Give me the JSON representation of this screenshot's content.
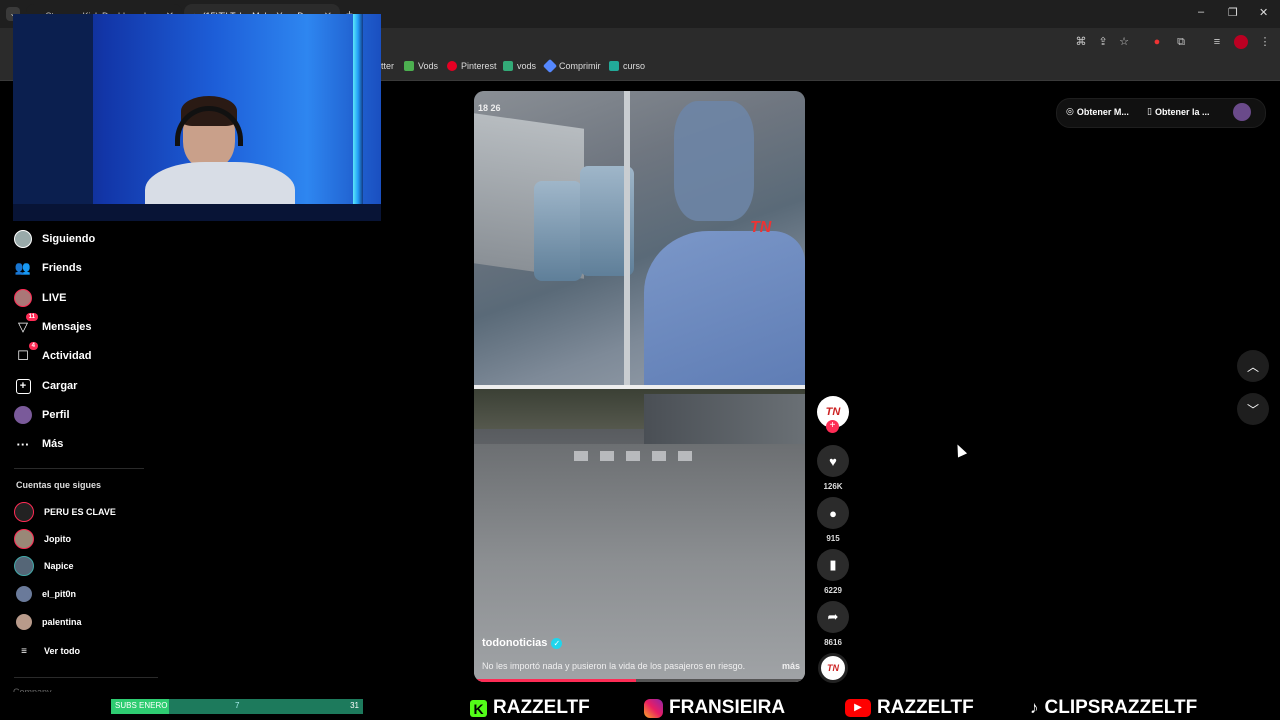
{
  "browser": {
    "tabs": [
      {
        "label": "Stream - Kick Dashboard"
      },
      {
        "label": "(15)TikTok - Make Your Day"
      }
    ],
    "bookmarks": [
      {
        "label": "tter"
      },
      {
        "label": "Vods"
      },
      {
        "label": "Pinterest"
      },
      {
        "label": "vods"
      },
      {
        "label": "Comprimir"
      },
      {
        "label": "curso"
      }
    ]
  },
  "sidebar": {
    "nav": [
      {
        "label": "Siguiendo",
        "icon": "following-icon"
      },
      {
        "label": "Friends",
        "icon": "friends-icon"
      },
      {
        "label": "LIVE",
        "icon": "live-icon"
      },
      {
        "label": "Mensajes",
        "icon": "messages-icon",
        "badge": "11"
      },
      {
        "label": "Actividad",
        "icon": "activity-icon",
        "badge": "4"
      },
      {
        "label": "Cargar",
        "icon": "upload-icon"
      },
      {
        "label": "Perfil",
        "icon": "profile-icon"
      },
      {
        "label": "Más",
        "icon": "more-icon"
      }
    ],
    "following_title": "Cuentas que sigues",
    "accounts": [
      {
        "name": "PERU ES CLAVE"
      },
      {
        "name": "Jopito"
      },
      {
        "name": "Napice"
      },
      {
        "name": "el_pit0n"
      },
      {
        "name": "palentina"
      }
    ],
    "see_all": "Ver todo",
    "company": "Company"
  },
  "header": {
    "get_app_1": "Obtener M...",
    "get_app_2": "Obtener la ..."
  },
  "video": {
    "author": "todonoticias",
    "caption": "No les importó nada y pusieron la vida de los pasajeros en riesgo.",
    "more": "más",
    "timestamp": "18 26",
    "progress": 0.49
  },
  "actions": {
    "avatar_text": "TN",
    "likes": "126K",
    "comments": "915",
    "saves": "6229",
    "shares": "8616"
  },
  "overlay": {
    "subs_label": "SUBS ENERO",
    "subs_current": "7",
    "subs_goal": "31",
    "subs_progress": 0.23,
    "socials": [
      {
        "icon": "kick-icon",
        "label": "RAZZELTF"
      },
      {
        "icon": "instagram-icon",
        "label": "FRANSIEIRA"
      },
      {
        "icon": "youtube-icon",
        "label": "RAZZELTF"
      },
      {
        "icon": "tiktok-icon",
        "label": "CLIPSRAZZELTF"
      }
    ]
  }
}
